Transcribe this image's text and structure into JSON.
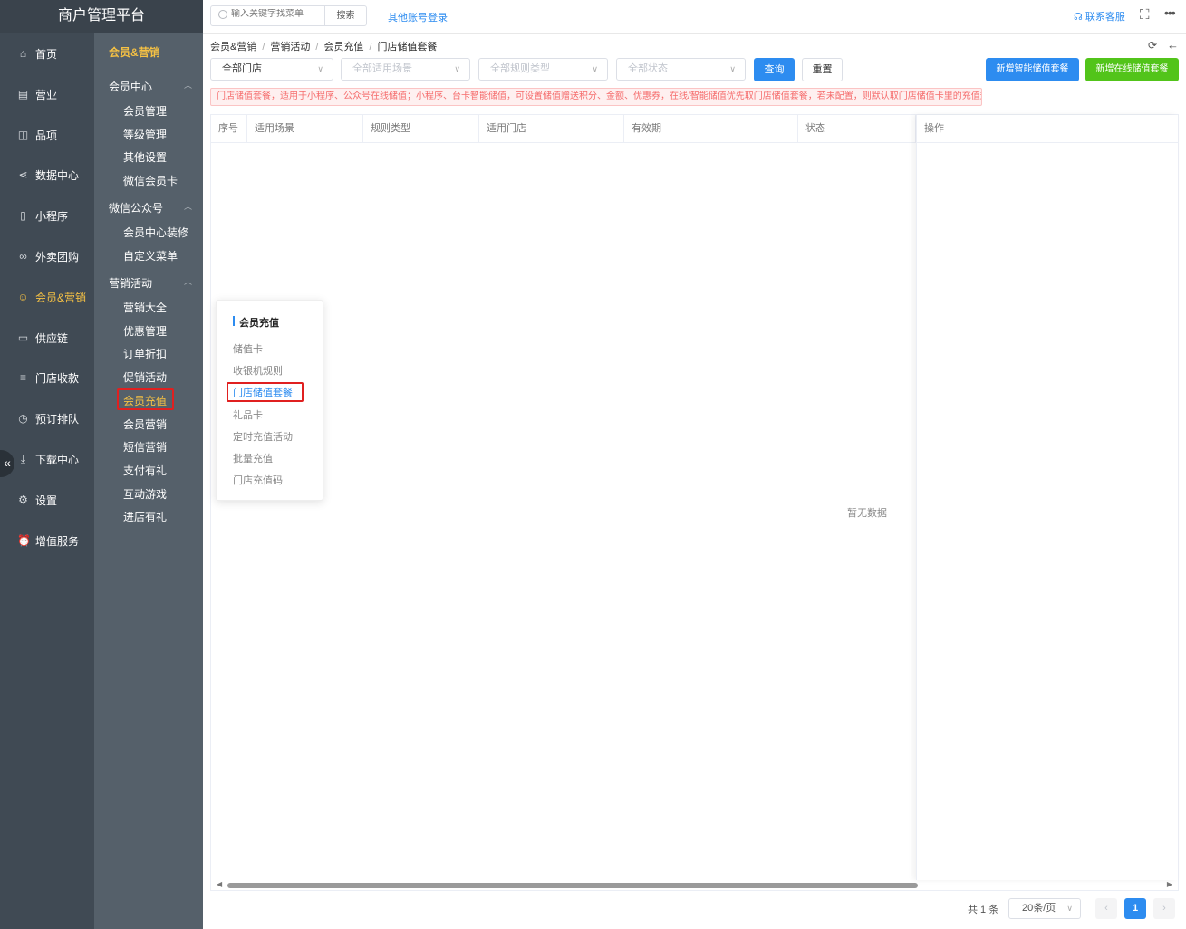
{
  "app": {
    "title": "商户管理平台"
  },
  "nav_primary": [
    {
      "label": "首页",
      "icon": "home-icon",
      "symbol": "⌂"
    },
    {
      "label": "营业",
      "icon": "calendar-icon",
      "symbol": "▤"
    },
    {
      "label": "品项",
      "icon": "bag-icon",
      "symbol": "◫"
    },
    {
      "label": "数据中心",
      "icon": "share-icon",
      "symbol": "⋖"
    },
    {
      "label": "小程序",
      "icon": "phone-icon",
      "symbol": "▯"
    },
    {
      "label": "外卖团购",
      "icon": "bike-icon",
      "symbol": "∞"
    },
    {
      "label": "会员&营销",
      "icon": "user-icon",
      "symbol": "☺",
      "active": true
    },
    {
      "label": "供应链",
      "icon": "truck-icon",
      "symbol": "▭"
    },
    {
      "label": "门店收款",
      "icon": "database-icon",
      "symbol": "≡"
    },
    {
      "label": "预订排队",
      "icon": "clock-icon",
      "symbol": "◷"
    },
    {
      "label": "下载中心",
      "icon": "download-icon",
      "symbol": "⤓"
    },
    {
      "label": "设置",
      "icon": "gear-icon",
      "symbol": "⚙"
    },
    {
      "label": "增值服务",
      "icon": "alarm-icon",
      "symbol": "⏰"
    }
  ],
  "nav_secondary": {
    "title": "会员&营销",
    "groups": [
      {
        "label": "会员中心",
        "items": [
          "会员管理",
          "等级管理",
          "其他设置",
          "微信会员卡"
        ]
      },
      {
        "label": "微信公众号",
        "items": [
          "会员中心装修",
          "自定义菜单"
        ]
      },
      {
        "label": "营销活动",
        "items": [
          "营销大全",
          "优惠管理",
          "订单折扣",
          "促销活动",
          "会员充值",
          "会员营销",
          "短信营销",
          "支付有礼",
          "互动游戏",
          "进店有礼"
        ]
      }
    ],
    "active_item": "会员充值"
  },
  "topbar": {
    "search_placeholder": "输入关键字找菜单",
    "search_button": "搜索",
    "other_login": "其他账号登录",
    "contact": "联系客服"
  },
  "breadcrumb": [
    "会员&营销",
    "营销活动",
    "会员充值",
    "门店储值套餐"
  ],
  "filters": {
    "store": "全部门店",
    "scene": "全部适用场景",
    "rule_type": "全部规则类型",
    "status": "全部状态"
  },
  "buttons": {
    "query": "查询",
    "reset": "重置",
    "add_smart": "新增智能储值套餐",
    "add_online": "新增在线储值套餐"
  },
  "notice": "门店储值套餐，适用于小程序、公众号在线储值；小程序、台卡智能储值，可设置储值赠送积分、金额、优惠券，在线/智能储值优先取门店储值套餐，若未配置，则默认取门店储值卡里的充值规则！",
  "table": {
    "columns": [
      "序号",
      "适用场景",
      "规则类型",
      "适用门店",
      "有效期",
      "状态"
    ],
    "fixed_column": "操作",
    "empty_text": "暂无数据"
  },
  "popup": {
    "title": "会员充值",
    "items": [
      "储值卡",
      "收银机规则",
      "门店储值套餐",
      "礼品卡",
      "定时充值活动",
      "批量充值",
      "门店充值码"
    ],
    "active_item": "门店储值套餐"
  },
  "pagination": {
    "total_text": "共 1 条",
    "page_size": "20条/页",
    "current_page": "1"
  },
  "colors": {
    "primary": "#2d8cf0",
    "success": "#52c41a",
    "accent": "#f5c144",
    "highlight": "#e02020"
  }
}
